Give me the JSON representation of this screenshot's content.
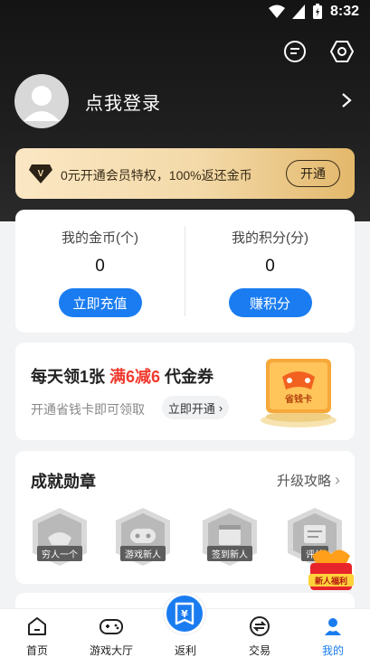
{
  "status": {
    "time": "8:32"
  },
  "profile": {
    "login_text": "点我登录"
  },
  "vip": {
    "text": "0元开通会员特权，100%返还金币",
    "button": "开通"
  },
  "wallet": {
    "coins_label": "我的金币(个)",
    "coins_value": "0",
    "coins_button": "立即充值",
    "points_label": "我的积分(分)",
    "points_value": "0",
    "points_button": "赚积分"
  },
  "coupon": {
    "title_prefix": "每天领1张 ",
    "title_highlight": "满6减6",
    "title_suffix": " 代金券",
    "subtitle": "开通省钱卡即可领取",
    "open_button": "立即开通",
    "card_label": "省钱卡"
  },
  "badges": {
    "title": "成就勋章",
    "more": "升级攻略",
    "items": [
      {
        "label": "穷人一个",
        "icon": "ingot-icon"
      },
      {
        "label": "游戏新人",
        "icon": "gamepad-icon"
      },
      {
        "label": "签到新人",
        "icon": "calendar-icon"
      },
      {
        "label": "评估",
        "icon": "chart-icon"
      }
    ],
    "newbie": "新人福利"
  },
  "tabs": [
    {
      "label": "首页",
      "icon": "home-icon"
    },
    {
      "label": "游戏大厅",
      "icon": "gamepad-icon"
    },
    {
      "label": "返利",
      "icon": "rebate-icon"
    },
    {
      "label": "交易",
      "icon": "exchange-icon"
    },
    {
      "label": "我的",
      "icon": "user-icon"
    }
  ],
  "colors": {
    "accent": "#1a7cf0",
    "highlight": "#f03a2e",
    "gold": "#f3d9a8"
  }
}
